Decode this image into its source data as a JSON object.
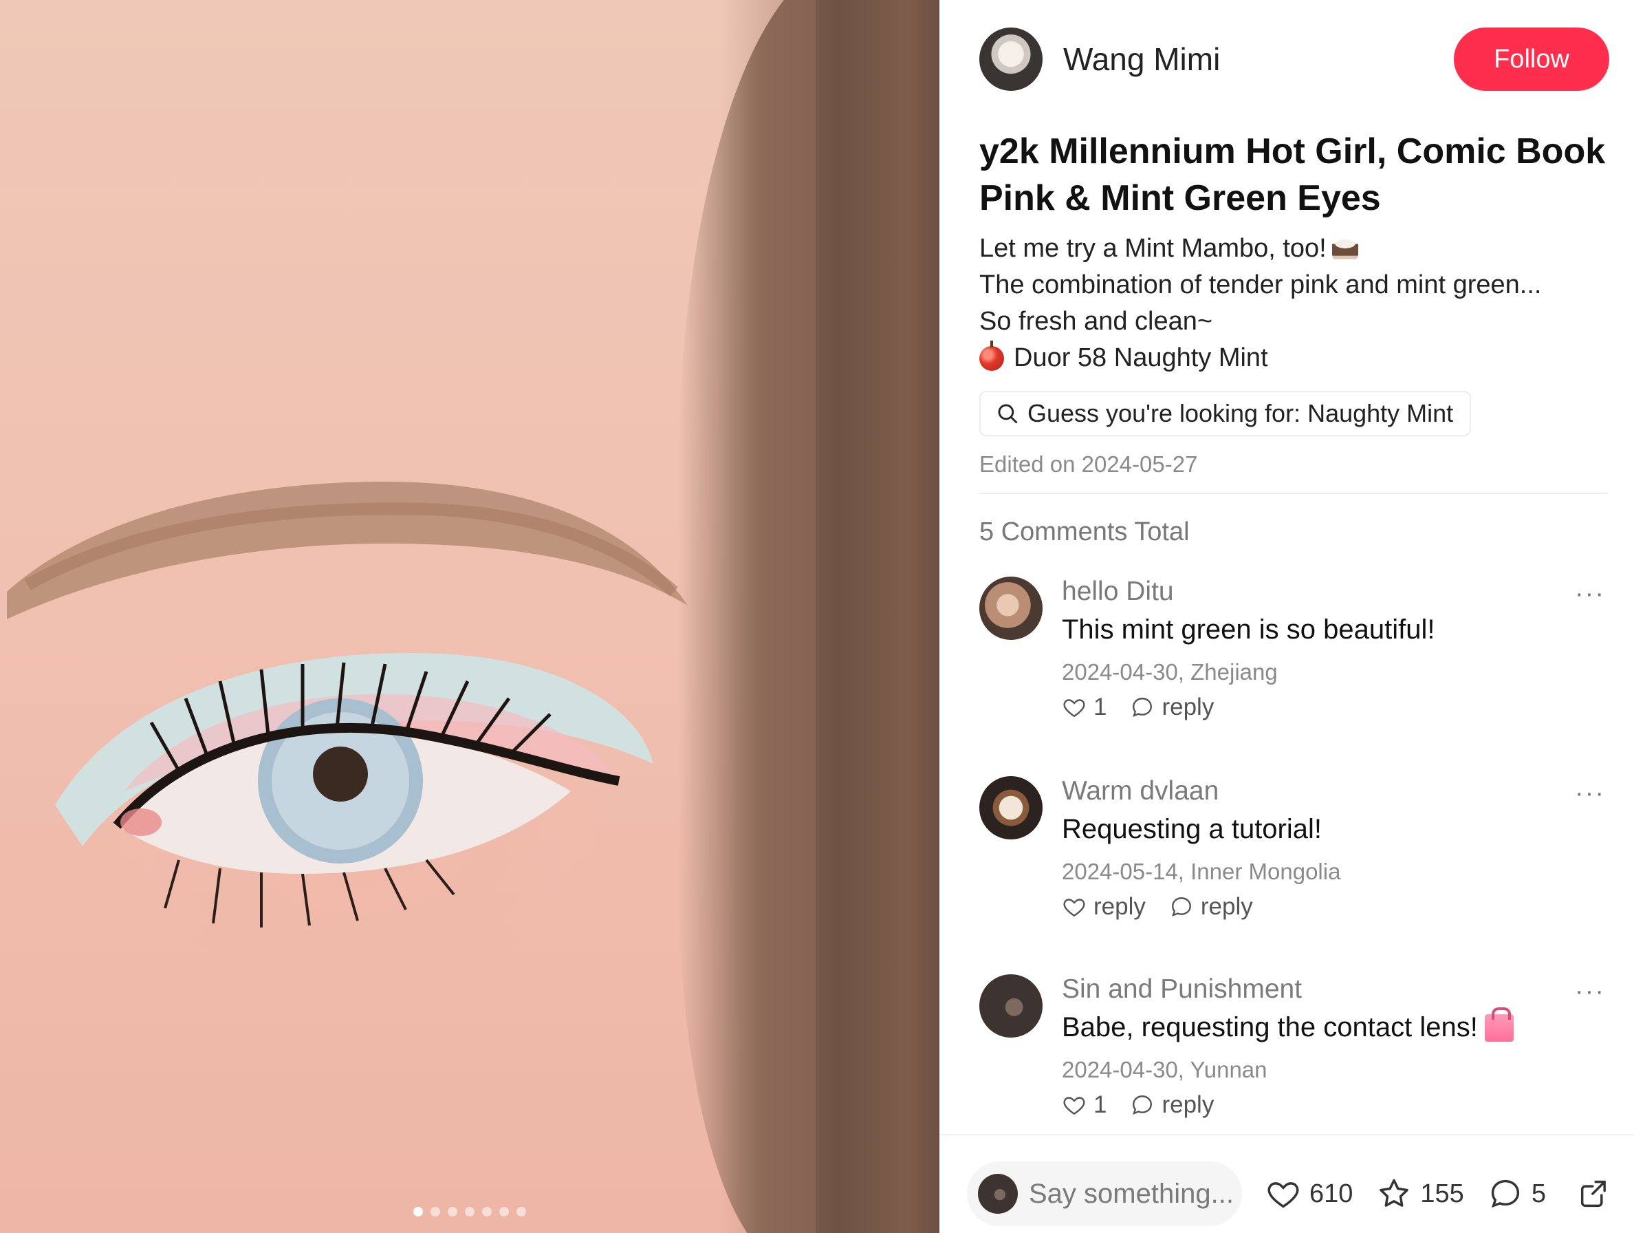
{
  "post": {
    "author": "Wang Mimi",
    "follow_label": "Follow",
    "title": "y2k Millennium Hot Girl, Comic Book Pink & Mint Green Eyes",
    "description": [
      "Let me try a Mint Mambo, too!",
      "The combination of tender pink and mint green...",
      "So fresh and clean~",
      "Duor 58 Naughty Mint"
    ],
    "search_suggestion": "Guess you're looking for: Naughty Mint",
    "edited": "Edited on 2024-05-27",
    "image_count": 7,
    "image_index": 1
  },
  "comments": {
    "total_label": "5 Comments Total",
    "items": [
      {
        "user": "hello Ditu",
        "text": "This mint green is so beautiful!",
        "meta": "2024-04-30, Zhejiang",
        "likes": "1",
        "reply": "reply"
      },
      {
        "user": "Warm dvlaan",
        "text": "Requesting a tutorial!",
        "meta": "2024-05-14, Inner Mongolia",
        "likes": "reply",
        "reply": "reply"
      },
      {
        "user": "Sin and Punishment",
        "text": "Babe, requesting the contact lens!",
        "meta": "2024-04-30, Yunnan",
        "likes": "1",
        "reply": "reply"
      }
    ],
    "more_label": "···"
  },
  "bottombar": {
    "placeholder": "Say something...",
    "likes": "610",
    "stars": "155",
    "comments": "5"
  },
  "colors": {
    "accent": "#ff2e4d",
    "muted": "#8a8a8a"
  },
  "icons": [
    "search-icon",
    "heart-icon",
    "comment-icon",
    "star-icon",
    "share-icon",
    "more-icon"
  ]
}
